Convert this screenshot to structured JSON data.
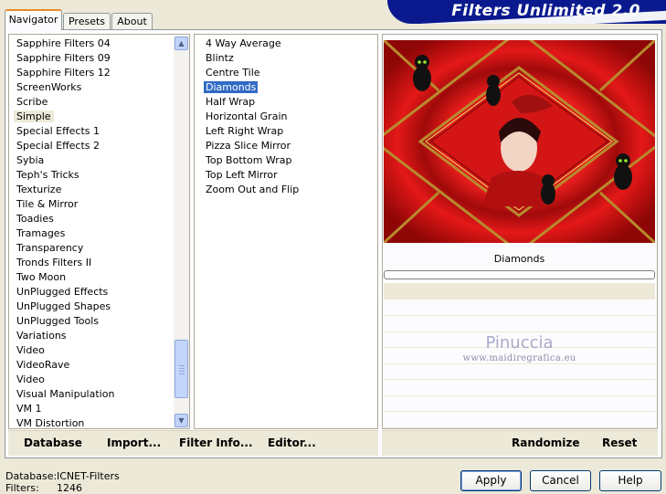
{
  "tabs": [
    {
      "label": "Navigator",
      "active": true
    },
    {
      "label": "Presets",
      "active": false
    },
    {
      "label": "About",
      "active": false
    }
  ],
  "banner_title": "Filters Unlimited 2.0",
  "categories": [
    "Sapphire Filters 04",
    "Sapphire Filters 09",
    "Sapphire Filters 12",
    "ScreenWorks",
    "Scribe",
    "Simple",
    "Special Effects 1",
    "Special Effects 2",
    "Sybia",
    "Teph's Tricks",
    "Texturize",
    "Tile & Mirror",
    "Toadies",
    "Tramages",
    "Transparency",
    "Tronds Filters II",
    "Two Moon",
    "UnPlugged Effects",
    "UnPlugged Shapes",
    "UnPlugged Tools",
    "Variations",
    "Video",
    "VideoRave",
    "Video",
    "Visual Manipulation",
    "VM 1",
    "VM Distortion"
  ],
  "selected_category": "Simple",
  "filters": [
    "4 Way Average",
    "Blintz",
    "Centre Tile",
    "Diamonds",
    "Half Wrap",
    "Horizontal Grain",
    "Left Right Wrap",
    "Pizza Slice Mirror",
    "Top Bottom Wrap",
    "Top Left Mirror",
    "Zoom Out and Flip"
  ],
  "selected_filter": "Diamonds",
  "preview_label": "Diamonds",
  "progress": 0,
  "watermark": {
    "name": "Pinuccia",
    "url": "www.maidiregrafica.eu"
  },
  "toolbar_left": {
    "database": "Database",
    "import": "Import...",
    "filter_info": "Filter Info...",
    "editor": "Editor..."
  },
  "toolbar_right": {
    "randomize": "Randomize",
    "reset": "Reset"
  },
  "status": {
    "database_label": "Database:",
    "database_value": "ICNET-Filters",
    "filters_label": "Filters:",
    "filters_value": "1246"
  },
  "buttons": {
    "apply": "Apply",
    "cancel": "Cancel",
    "help": "Help"
  },
  "colors": {
    "selection": "#316AC5",
    "banner": "#0A1A8E",
    "face": "#ECE9D8"
  },
  "icons": {
    "scroll_up": "chevron-up-icon",
    "scroll_down": "chevron-down-icon"
  }
}
